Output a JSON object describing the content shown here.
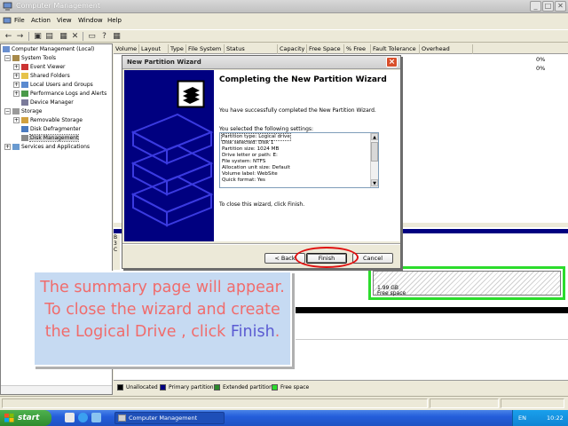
{
  "window": {
    "title": "Computer Management",
    "controls": {
      "minimize": "_",
      "maximize": "□",
      "close": "✕"
    }
  },
  "menu": [
    "File",
    "Action",
    "View",
    "Window",
    "Help"
  ],
  "toolbar_icons": [
    "back-icon",
    "forward-icon",
    "up-icon",
    "console-tree-icon",
    "properties-icon",
    "delete-icon",
    "export-icon",
    "help-icon",
    "grid-icon"
  ],
  "tree": {
    "root": "Computer Management (Local)",
    "system_tools": "System Tools",
    "event_viewer": "Event Viewer",
    "shared_folders": "Shared Folders",
    "local_users": "Local Users and Groups",
    "perf_logs": "Performance Logs and Alerts",
    "device_manager": "Device Manager",
    "storage": "Storage",
    "removable_storage": "Removable Storage",
    "disk_defrag": "Disk Defragmenter",
    "disk_management": "Disk Management",
    "services": "Services and Applications"
  },
  "volume_columns": [
    "Volume",
    "Layout",
    "Type",
    "File System",
    "Status",
    "Capacity",
    "Free Space",
    "% Free",
    "Fault Tolerance",
    "Overhead"
  ],
  "volume_rows": [
    {
      "pct_free": "0%"
    },
    {
      "pct_free": "0%"
    }
  ],
  "disk_graph": {
    "left_labels": [
      "B",
      "3",
      "C"
    ],
    "free_size": "1.99 GB",
    "free_label": "Free space"
  },
  "legend": [
    {
      "label": "Unallocated",
      "color": "#000000"
    },
    {
      "label": "Primary partition",
      "color": "#000080"
    },
    {
      "label": "Extended partition",
      "color": "#2d8b2d"
    },
    {
      "label": "Free space",
      "color": "#2cdc2c"
    }
  ],
  "dialog": {
    "title": "New Partition Wizard",
    "heading": "Completing the New Partition Wizard",
    "message": "You have successfully completed the New Partition Wizard.",
    "selected_label": "You selected the following settings:",
    "summary": [
      "Partition type: Logical drive",
      "Disk selected: Disk 1",
      "Partition size: 1024 MB",
      "Drive letter or path: E:",
      "File system: NTFS",
      "Allocation unit size: Default",
      "Volume label: WebSite",
      "Quick format: Yes"
    ],
    "close_msg": "To close this wizard, click Finish.",
    "back_label": "< Back",
    "finish_label": "Finish",
    "cancel_label": "Cancel"
  },
  "callout": {
    "text_before": "The summary page will appear. To close the wizard and create the Logical Drive , click ",
    "highlight": "Finish",
    "text_after": "."
  },
  "taskbar": {
    "start_label": "start",
    "task_label": "Computer Management",
    "language": "EN",
    "clock": "10:22"
  }
}
